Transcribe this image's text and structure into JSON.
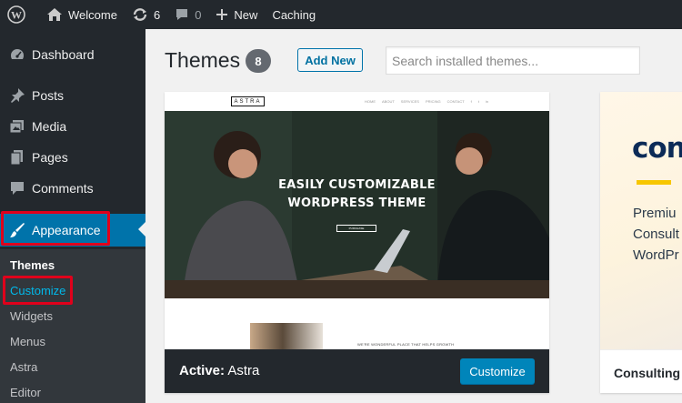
{
  "adminbar": {
    "site_name": "Welcome",
    "updates_count": "6",
    "comments_count": "0",
    "new_label": "New",
    "caching_label": "Caching"
  },
  "sidebar": {
    "items": [
      {
        "label": "Dashboard",
        "icon": "dashboard-icon"
      },
      {
        "label": "Posts",
        "icon": "pin-icon"
      },
      {
        "label": "Media",
        "icon": "media-icon"
      },
      {
        "label": "Pages",
        "icon": "pages-icon"
      },
      {
        "label": "Comments",
        "icon": "comment-icon"
      },
      {
        "label": "Appearance",
        "icon": "brush-icon"
      }
    ],
    "submenu": [
      "Themes",
      "Customize",
      "Widgets",
      "Menus",
      "Astra",
      "Editor"
    ]
  },
  "main": {
    "title": "Themes",
    "count": "8",
    "add_new": "Add New",
    "search_placeholder": "Search installed themes..."
  },
  "theme_active": {
    "screenshot": {
      "logo": "ASTRA",
      "nav": [
        "HOME",
        "ABOUT",
        "SERVICES",
        "PRICING",
        "CONTACT",
        "f",
        "t",
        "in"
      ],
      "hero_line1": "EASILY CUSTOMIZABLE",
      "hero_line2": "WORDPRESS THEME",
      "hero_button": "PURCHASE",
      "lower_text": "WE'RE WONDERFUL PLACE THAT HELPS GROWTH"
    },
    "active_prefix": "Active:",
    "name": "Astra",
    "customize": "Customize"
  },
  "theme_second": {
    "logo": "con",
    "text_line1": "Premiu",
    "text_line2": "Consult",
    "text_line3": "WordPr",
    "name": "Consulting"
  },
  "colors": {
    "adminbar_bg": "#23282d",
    "accent": "#0073aa",
    "button": "#0085ba",
    "highlight": "#e0001b"
  }
}
